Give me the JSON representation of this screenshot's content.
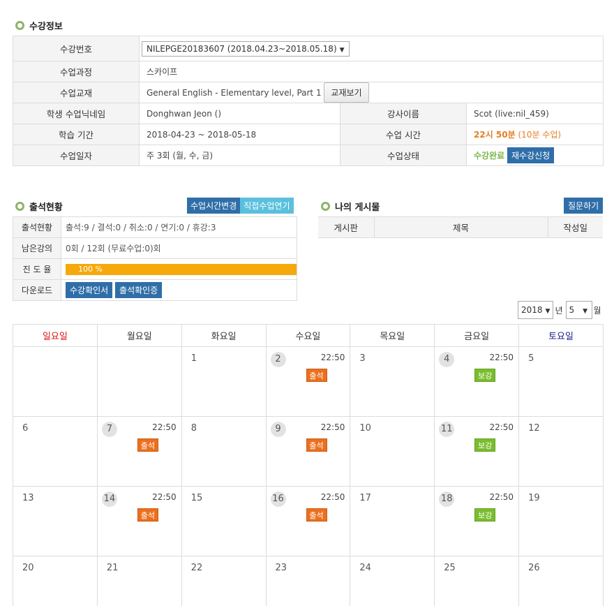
{
  "enroll": {
    "title": "수강정보",
    "rows": {
      "course_no_label": "수강번호",
      "course_no_value": "NILEPGE20183607 (2018.04.23~2018.05.18)",
      "course_label": "수업과정",
      "course_value": "스카이프",
      "material_label": "수업교재",
      "material_value": "General English - Elementary level, Part 1",
      "material_button": "교재보기",
      "nickname_label": "학생 수업닉네임",
      "nickname_value": "Donghwan Jeon ()",
      "teacher_label": "강사이름",
      "teacher_value": "Scot (live:nil_459)",
      "period_label": "학습 기간",
      "period_value": "2018-04-23 ~ 2018-05-18",
      "time_label": "수업 시간",
      "time_value": "22시 50분",
      "time_duration": "(10분 수업)",
      "days_label": "수업일자",
      "days_value": "주 3회 (월, 수, 금)",
      "status_label": "수업상태",
      "status_value": "수강완료",
      "reenroll_button": "재수강신청"
    }
  },
  "attendance": {
    "title": "출석현황",
    "change_time_button": "수업시간변경",
    "postpone_button": "직접수업연기",
    "status_label": "출석현황",
    "status_value": "출석:9 / 결석:0 / 취소:0 / 연기:0 / 휴강:3",
    "remaining_label": "남은강의",
    "remaining_value": "0회 / 12회 (무료수업:0)회",
    "progress_label": "진 도 율",
    "progress_text": "100 %",
    "progress_fraction": 1.0,
    "download_label": "다운로드",
    "cert_button": "수강확인서",
    "attend_cert_button": "출석확인증"
  },
  "posts": {
    "title": "나의 게시물",
    "ask_button": "질문하기",
    "columns": [
      "게시판",
      "제목",
      "작성일"
    ]
  },
  "calendar": {
    "year": "2018",
    "year_suffix": "년",
    "month": "5",
    "month_suffix": "월",
    "weekdays": [
      "일요일",
      "월요일",
      "화요일",
      "수요일",
      "목요일",
      "금요일",
      "토요일"
    ],
    "weeks": [
      [
        {
          "day": ""
        },
        {
          "day": ""
        },
        {
          "day": "1"
        },
        {
          "day": "2",
          "time": "22:50",
          "badge": "출석",
          "kind": "o"
        },
        {
          "day": "3"
        },
        {
          "day": "4",
          "time": "22:50",
          "badge": "보강",
          "kind": "g"
        },
        {
          "day": "5"
        }
      ],
      [
        {
          "day": "6"
        },
        {
          "day": "7",
          "time": "22:50",
          "badge": "출석",
          "kind": "o"
        },
        {
          "day": "8"
        },
        {
          "day": "9",
          "time": "22:50",
          "badge": "출석",
          "kind": "o"
        },
        {
          "day": "10"
        },
        {
          "day": "11",
          "time": "22:50",
          "badge": "보강",
          "kind": "g"
        },
        {
          "day": "12"
        }
      ],
      [
        {
          "day": "13"
        },
        {
          "day": "14",
          "time": "22:50",
          "badge": "출석",
          "kind": "o"
        },
        {
          "day": "15"
        },
        {
          "day": "16",
          "time": "22:50",
          "badge": "출석",
          "kind": "o"
        },
        {
          "day": "17"
        },
        {
          "day": "18",
          "time": "22:50",
          "badge": "보강",
          "kind": "g"
        },
        {
          "day": "19"
        }
      ],
      [
        {
          "day": "20"
        },
        {
          "day": "21"
        },
        {
          "day": "22"
        },
        {
          "day": "23"
        },
        {
          "day": "24"
        },
        {
          "day": "25"
        },
        {
          "day": "26"
        }
      ]
    ]
  }
}
